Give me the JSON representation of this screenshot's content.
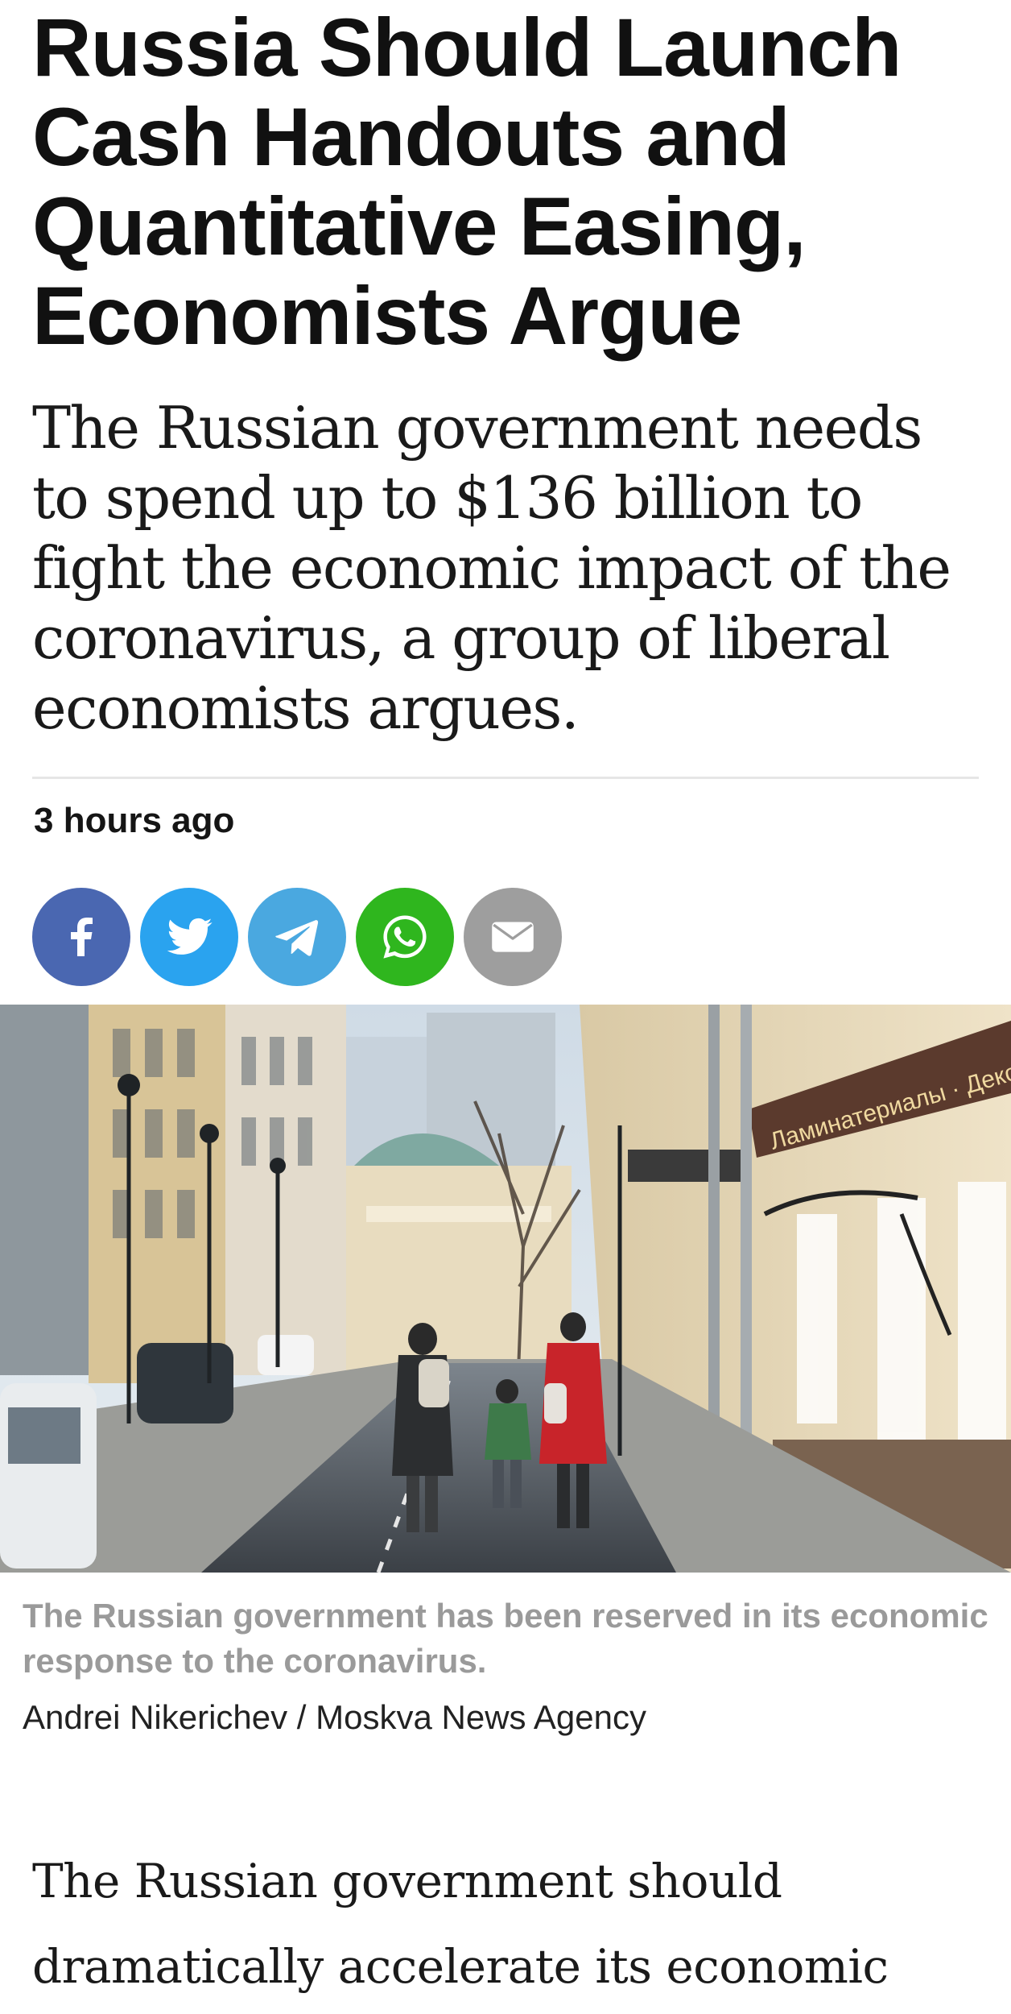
{
  "article": {
    "headline": "Russia Should Launch Cash Handouts and Quantitative Easing, Economists Argue",
    "lede": "The Russian government needs to spend up to $136 billion to fight the economic impact of the coronavirus, a group of liberal economists argues.",
    "timestamp": "3 hours ago",
    "body_start": "The Russian government should dramatically accelerate its economic relief"
  },
  "share": {
    "buttons": [
      {
        "name": "facebook",
        "icon": "facebook-icon",
        "color": "#4a67b1"
      },
      {
        "name": "twitter",
        "icon": "twitter-icon",
        "color": "#2aa3ef"
      },
      {
        "name": "telegram",
        "icon": "telegram-icon",
        "color": "#4aa8e0"
      },
      {
        "name": "whatsapp",
        "icon": "whatsapp-icon",
        "color": "#2fb61e"
      },
      {
        "name": "email",
        "icon": "mail-icon",
        "color": "#9e9e9e"
      }
    ]
  },
  "photo": {
    "caption": "The Russian government has been reserved in its economic response to the coronavirus.",
    "credit": "Andrei Nikerichev / Moskva News Agency"
  },
  "signage": {
    "storefront": "Ламинатериалы · Декор"
  }
}
